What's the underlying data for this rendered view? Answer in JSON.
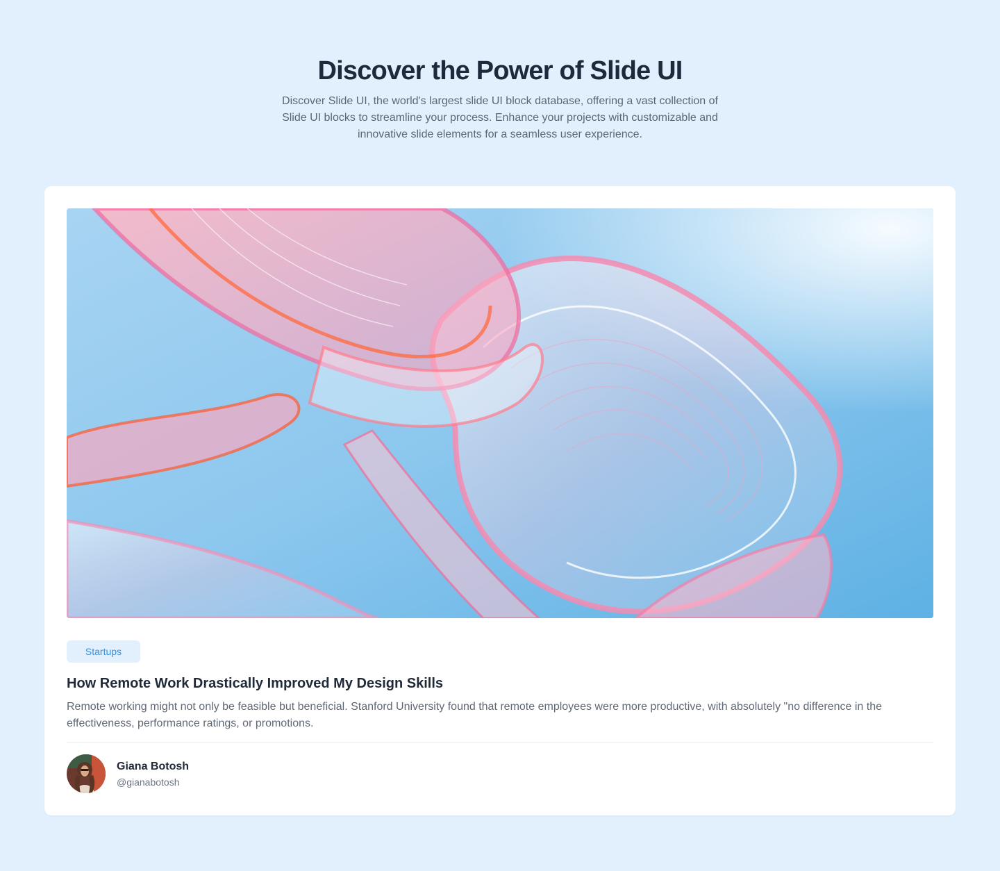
{
  "header": {
    "title": "Discover the Power of Slide UI",
    "subtitle": "Discover Slide UI, the world's largest slide UI block database, offering a vast collection of Slide UI blocks to streamline your process. Enhance your projects with customizable and innovative slide elements for a seamless user experience."
  },
  "post": {
    "category": "Startups",
    "title": "How Remote Work Drastically Improved My Design Skills",
    "excerpt": "Remote working might not only be feasible but beneficial. Stanford University found that remote employees were more productive, with absolutely \"no difference in the effectiveness, performance ratings, or promotions.",
    "image_alt": "Abstract pink and orange glass ribbons against a blue sky"
  },
  "author": {
    "name": "Giana Botosh",
    "handle": "@gianabotosh"
  },
  "colors": {
    "background": "#e2f0fd",
    "tag_background": "#e1f0fc",
    "tag_text": "#3d8fd8"
  }
}
